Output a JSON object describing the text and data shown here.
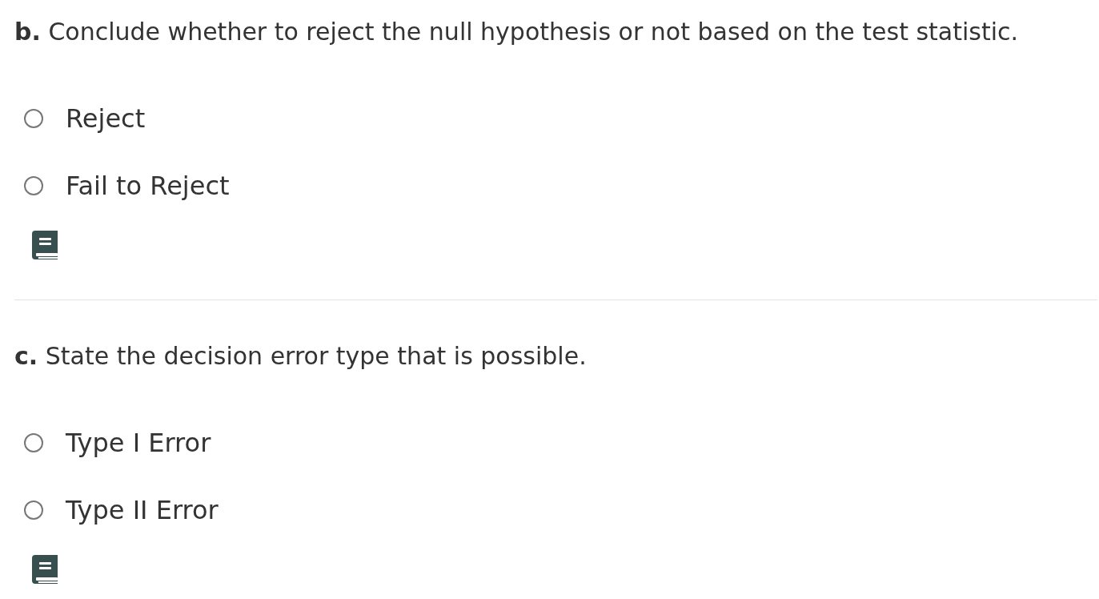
{
  "questions": [
    {
      "prompt": "**b.** Conclude whether to reject the null hypothesis or not based on the test statistic.",
      "options": [
        {
          "label": "Reject",
          "selected": false
        },
        {
          "label": "Fail to Reject",
          "selected": false
        }
      ]
    },
    {
      "prompt": "**c.** State the decision error type that is possible.",
      "options": [
        {
          "label": "Type I Error",
          "selected": false
        },
        {
          "label": "Type II Error",
          "selected": false
        }
      ]
    }
  ]
}
